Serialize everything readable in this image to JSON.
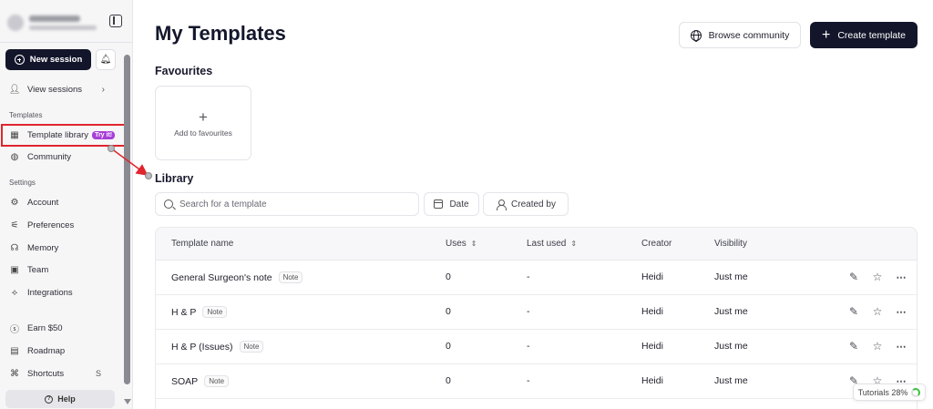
{
  "sidebar": {
    "new_session": "New session",
    "view_sessions": "View sessions",
    "section_templates": "Templates",
    "template_library": "Template library",
    "try_badge": "Try it!",
    "community": "Community",
    "section_settings": "Settings",
    "account": "Account",
    "preferences": "Preferences",
    "memory": "Memory",
    "team": "Team",
    "integrations": "Integrations",
    "earn": "Earn $50",
    "roadmap": "Roadmap",
    "shortcuts": "Shortcuts",
    "shortcuts_key": "S",
    "help": "Help"
  },
  "header": {
    "title": "My Templates",
    "browse_community": "Browse community",
    "create_template": "Create template"
  },
  "favourites": {
    "heading": "Favourites",
    "add_label": "Add to favourites"
  },
  "library": {
    "heading": "Library",
    "search_placeholder": "Search for a template",
    "date_filter": "Date",
    "created_by_filter": "Created by",
    "columns": {
      "name": "Template name",
      "uses": "Uses",
      "last_used": "Last used",
      "creator": "Creator",
      "visibility": "Visibility"
    },
    "rows": [
      {
        "name": "General Surgeon's note",
        "tag": "Note",
        "uses": "0",
        "last_used": "-",
        "creator": "Heidi",
        "visibility": "Just me"
      },
      {
        "name": "H & P",
        "tag": "Note",
        "uses": "0",
        "last_used": "-",
        "creator": "Heidi",
        "visibility": "Just me"
      },
      {
        "name": "H & P (Issues)",
        "tag": "Note",
        "uses": "0",
        "last_used": "-",
        "creator": "Heidi",
        "visibility": "Just me"
      },
      {
        "name": "SOAP",
        "tag": "Note",
        "uses": "0",
        "last_used": "-",
        "creator": "Heidi",
        "visibility": "Just me"
      }
    ]
  },
  "tutorials": {
    "label": "Tutorials 28%",
    "progress": 0.28
  },
  "colors": {
    "primary_dark": "#13162a",
    "badge_purple": "#a83fd8",
    "annotation_red": "#e0252e",
    "progress_green": "#3fbf3f"
  },
  "icons": [
    "sidebar-collapse-icon",
    "plus-circle-icon",
    "bell-icon",
    "sessions-icon",
    "template-library-icon",
    "globe-icon",
    "gear-icon",
    "sliders-icon",
    "brain-icon",
    "team-icon",
    "integrations-icon",
    "dollar-icon",
    "map-icon",
    "command-icon",
    "help-icon",
    "search-icon",
    "calendar-icon",
    "user-icon",
    "sort-icon",
    "pencil-icon",
    "star-icon",
    "more-icon"
  ]
}
